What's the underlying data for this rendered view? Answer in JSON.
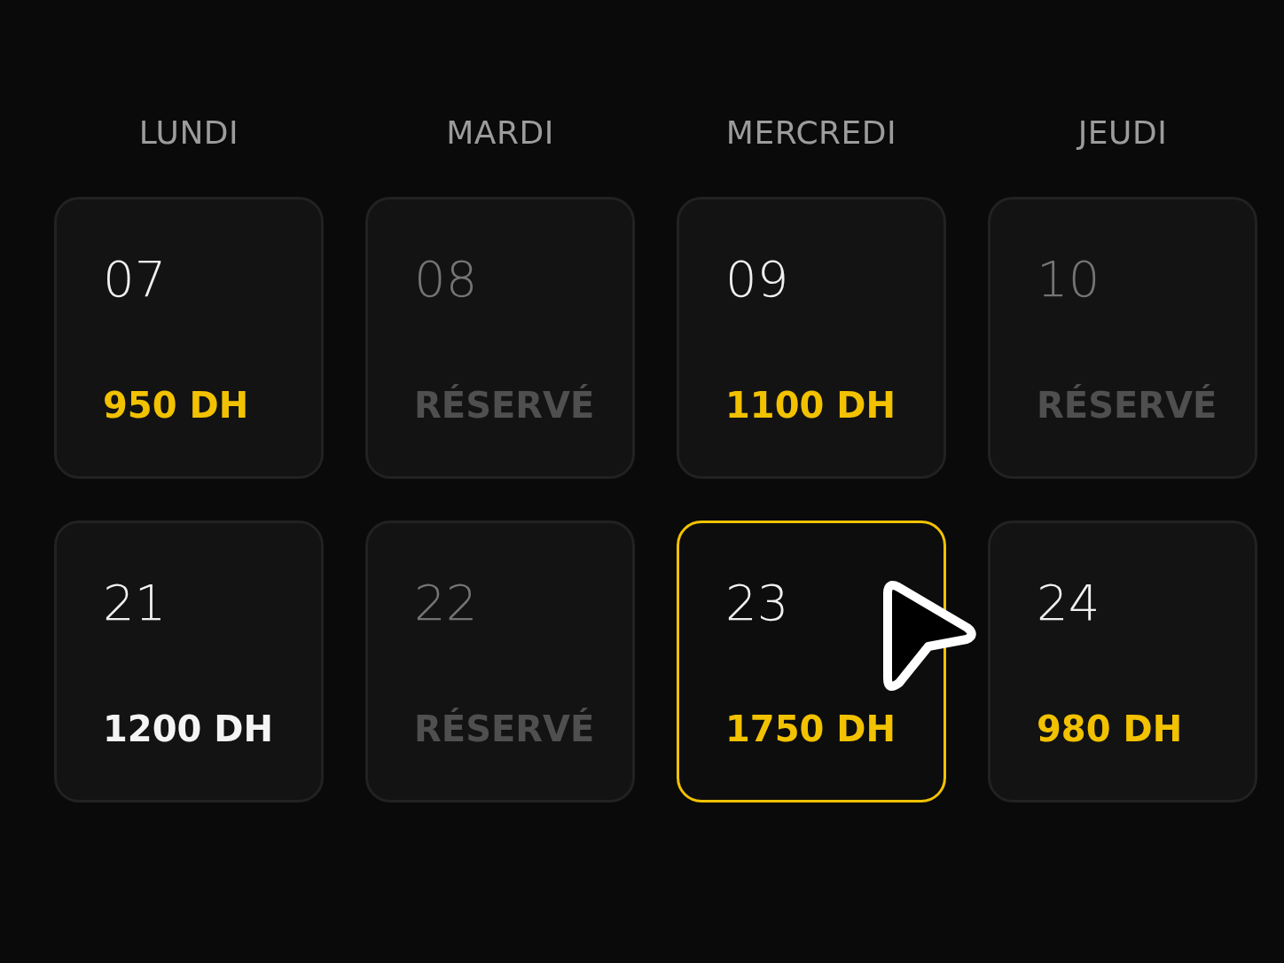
{
  "weekdays": [
    "LUNDI",
    "MARDI",
    "MERCREDI",
    "JEUDI"
  ],
  "weeks": [
    {
      "days": [
        {
          "number": "07",
          "kind": "available",
          "status": "950 DH",
          "selected": false
        },
        {
          "number": "08",
          "kind": "reserved",
          "status": "RÉSERVÉ",
          "selected": false
        },
        {
          "number": "09",
          "kind": "available",
          "status": "1100 DH",
          "selected": false
        },
        {
          "number": "10",
          "kind": "reserved",
          "status": "RÉSERVÉ",
          "selected": false
        }
      ]
    },
    {
      "days": [
        {
          "number": "21",
          "kind": "regular",
          "status": "1200 DH",
          "selected": false
        },
        {
          "number": "22",
          "kind": "reserved",
          "status": "RÉSERVÉ",
          "selected": false
        },
        {
          "number": "23",
          "kind": "available",
          "status": "1750 DH",
          "selected": true
        },
        {
          "number": "24",
          "kind": "available",
          "status": "980 DH",
          "selected": false
        }
      ]
    }
  ]
}
